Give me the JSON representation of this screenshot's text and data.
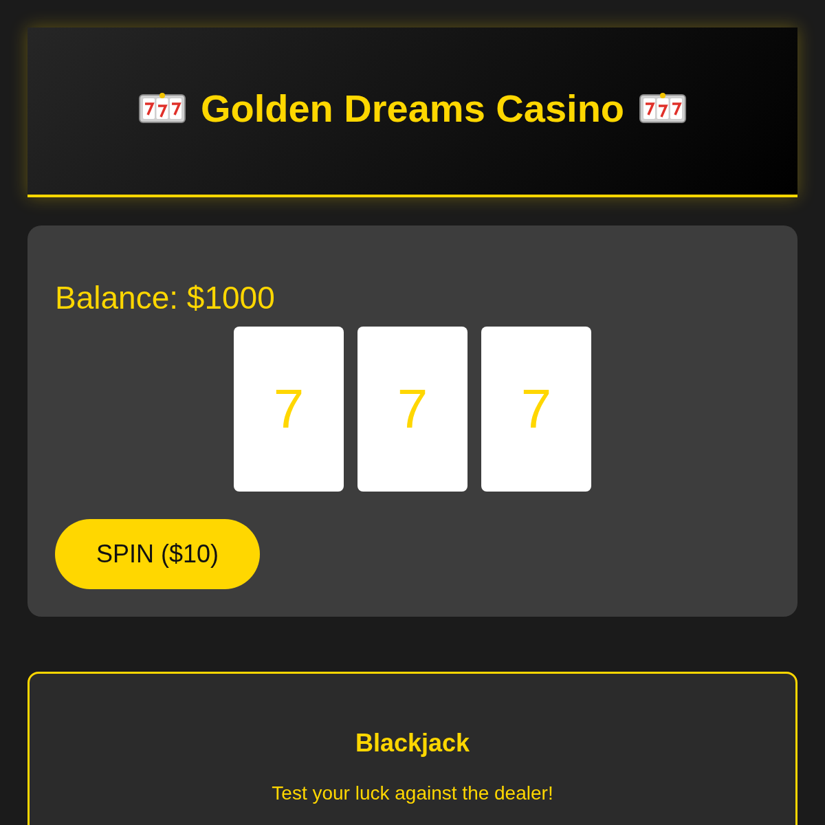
{
  "header": {
    "title": "Golden Dreams Casino"
  },
  "slots": {
    "balance": "Balance: $1000",
    "reels": [
      "7",
      "7",
      "7"
    ],
    "spin_button": "SPIN ($10)"
  },
  "games": [
    {
      "title": "Blackjack",
      "description": "Test your luck against the dealer!"
    }
  ]
}
